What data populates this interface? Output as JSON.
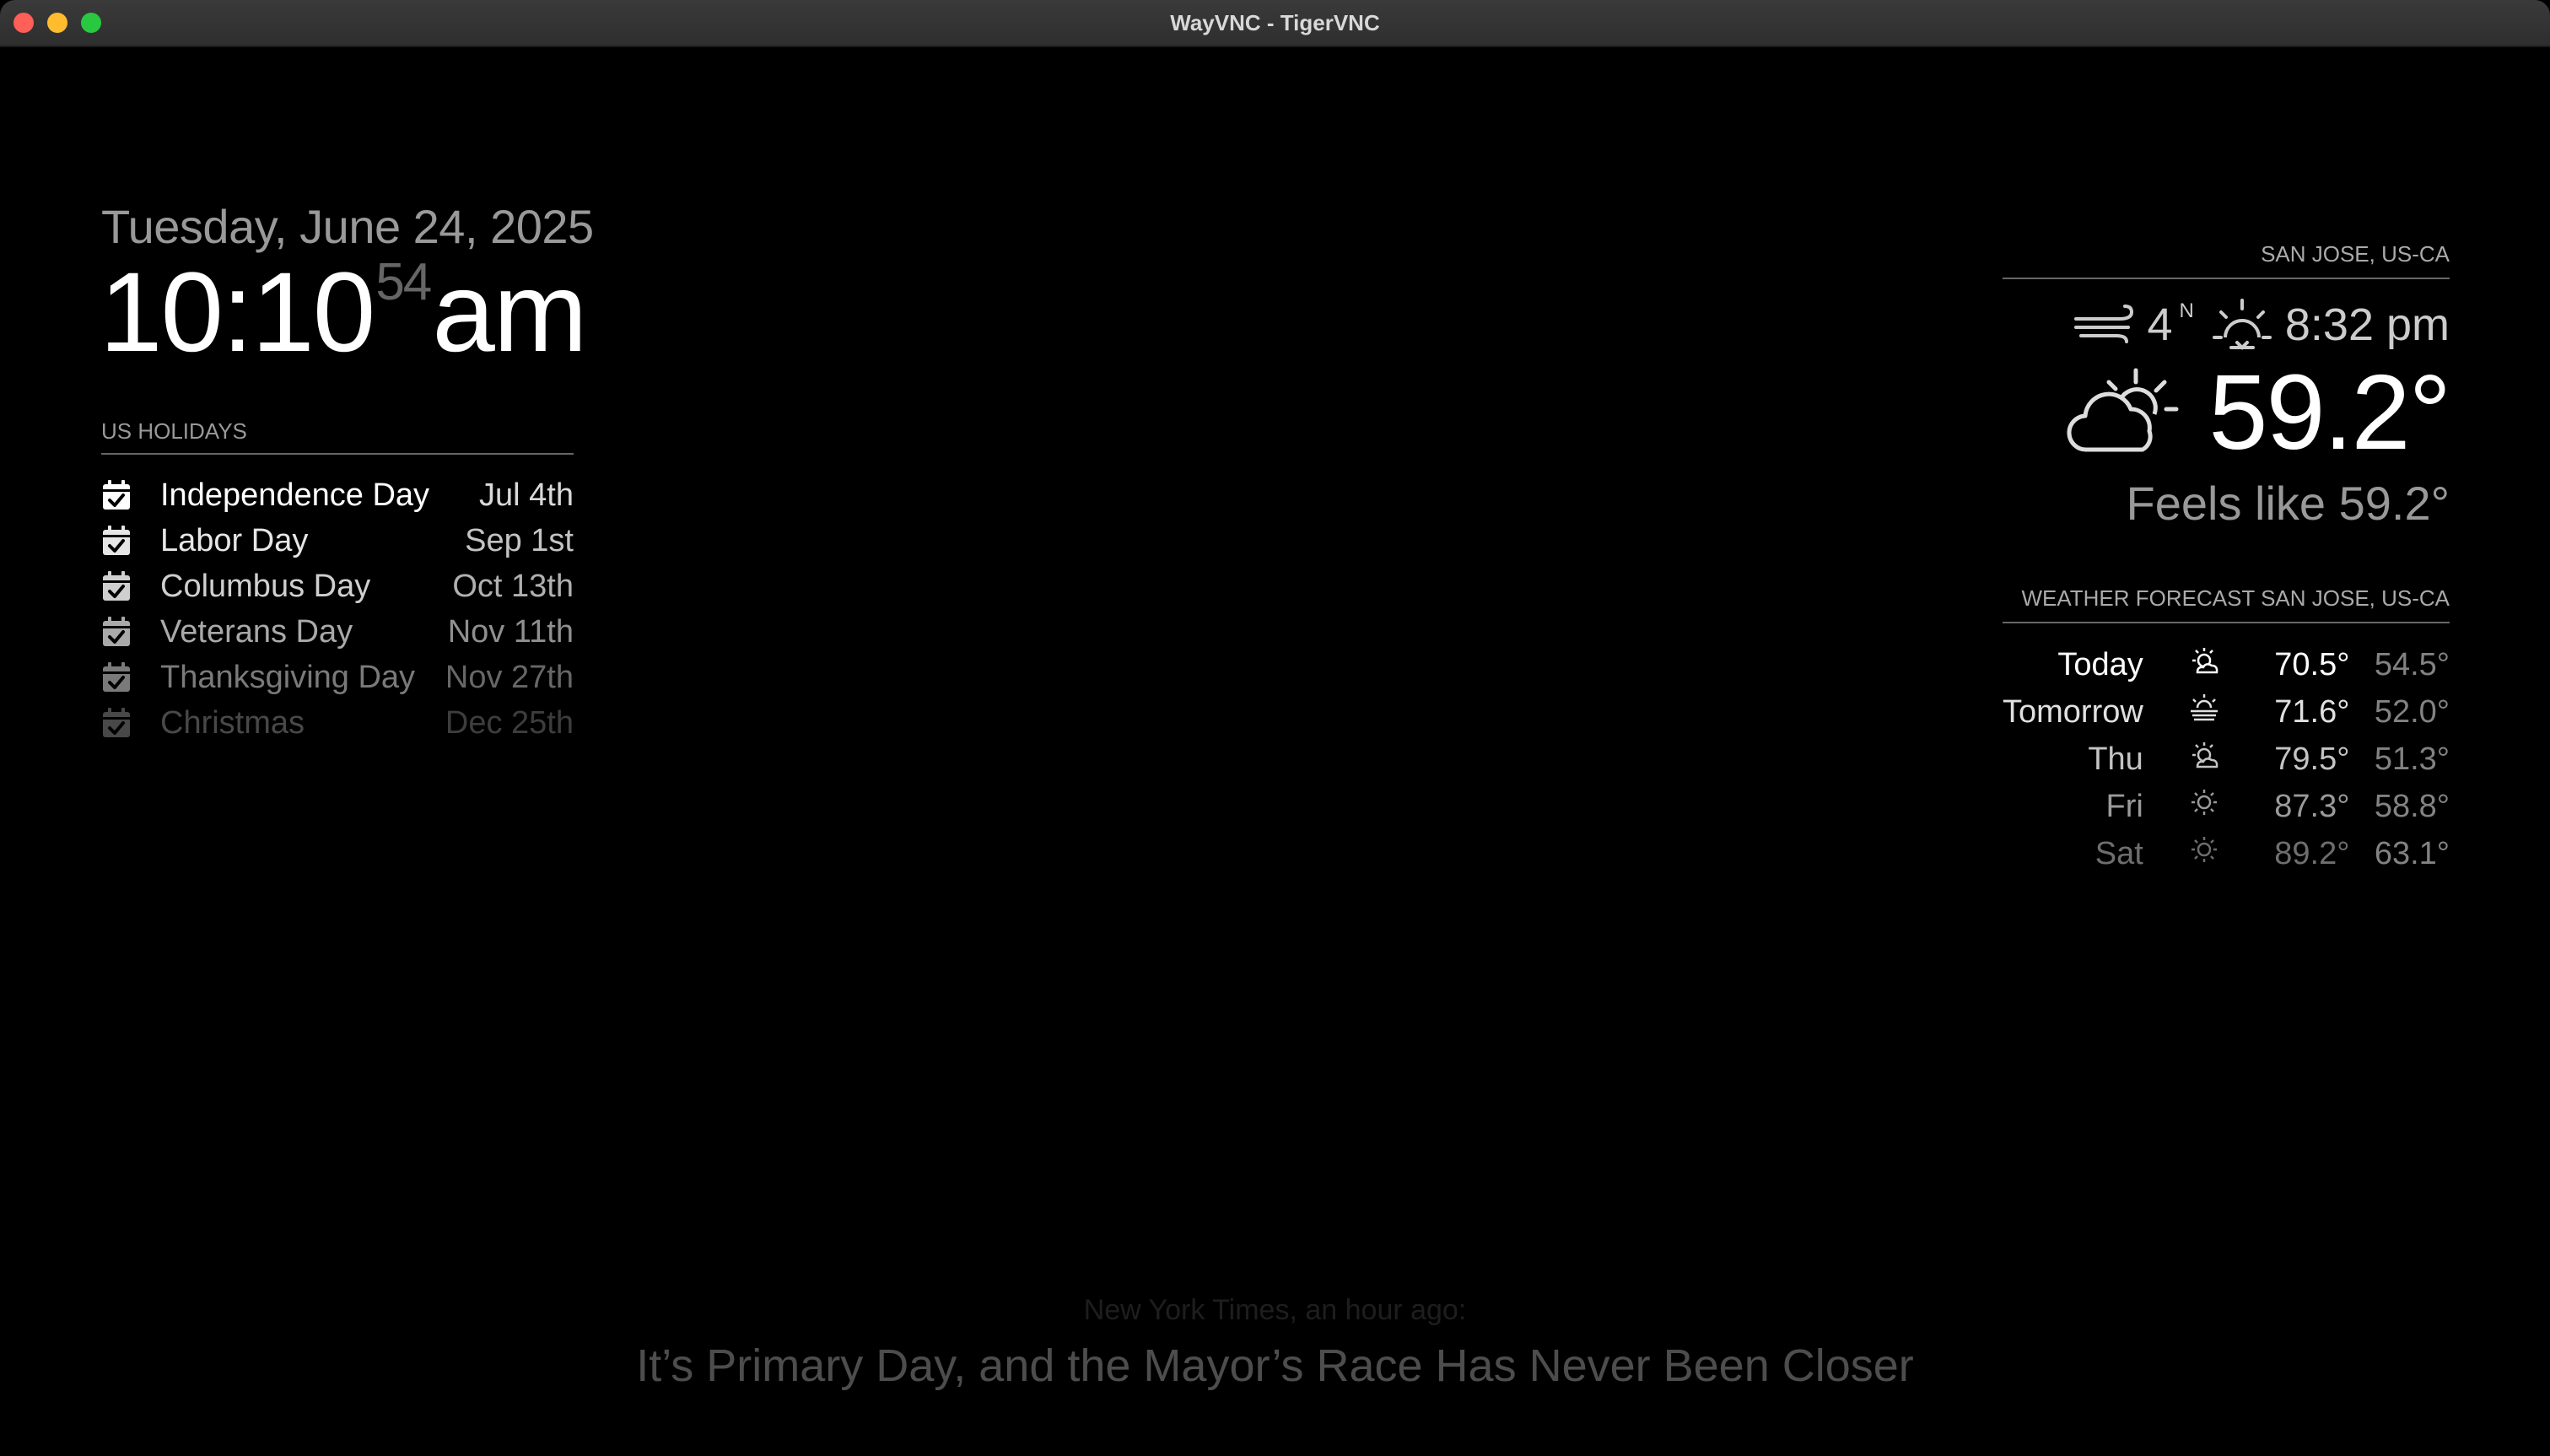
{
  "window": {
    "title": "WayVNC - TigerVNC"
  },
  "clock": {
    "date": "Tuesday, June 24, 2025",
    "hours_minutes": "10:10",
    "seconds": "54",
    "period": "am"
  },
  "holidays": {
    "header": "US HOLIDAYS",
    "items": [
      {
        "name": "Independence Day",
        "date": "Jul 4th",
        "color": "#ffffff"
      },
      {
        "name": "Labor Day",
        "date": "Sep 1st",
        "color": "#e6e6e6"
      },
      {
        "name": "Columbus Day",
        "date": "Oct 13th",
        "color": "#cfcfcf"
      },
      {
        "name": "Veterans Day",
        "date": "Nov 11th",
        "color": "#a9a9a9"
      },
      {
        "name": "Thanksgiving Day",
        "date": "Nov 27th",
        "color": "#7a7a7a"
      },
      {
        "name": "Christmas",
        "date": "Dec 25th",
        "color": "#484848"
      }
    ]
  },
  "weather": {
    "city_header": "SAN JOSE, US-CA",
    "wind_speed": "4",
    "wind_direction": "N",
    "sunset_time": "8:32 pm",
    "current_icon": "partly-cloudy-day-icon",
    "temperature": "59.2°",
    "feels_like": "Feels like 59.2°"
  },
  "forecast": {
    "header": "WEATHER FORECAST SAN JOSE, US-CA",
    "days": [
      {
        "day": "Today",
        "icon": "sun-cloud-icon",
        "high": "70.5°",
        "low": "54.5°",
        "color": "#ffffff"
      },
      {
        "day": "Tomorrow",
        "icon": "sun-haze-icon",
        "high": "71.6°",
        "low": "52.0°",
        "color": "#e0e0e0"
      },
      {
        "day": "Thu",
        "icon": "sun-cloud-icon",
        "high": "79.5°",
        "low": "51.3°",
        "color": "#c4c4c4"
      },
      {
        "day": "Fri",
        "icon": "sun-icon",
        "high": "87.3°",
        "low": "58.8°",
        "color": "#9a9a9a"
      },
      {
        "day": "Sat",
        "icon": "sun-icon",
        "high": "89.2°",
        "low": "63.1°",
        "color": "#6e6e6e"
      }
    ]
  },
  "compliment": {
    "text": ""
  },
  "news": {
    "source": "New York Times, an hour ago:",
    "headline": "It’s Primary Day, and the Mayor’s Race Has Never Been Closer"
  }
}
